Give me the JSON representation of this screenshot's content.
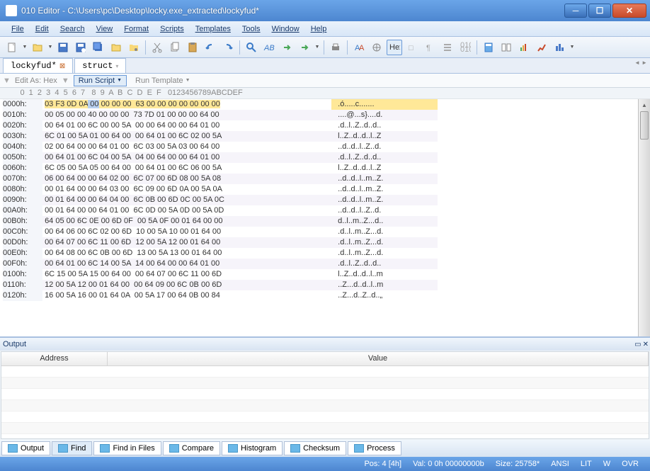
{
  "title": "010 Editor - C:\\Users\\pc\\Desktop\\locky.exe_extracted\\lockyfud*",
  "menus": [
    "File",
    "Edit",
    "Search",
    "View",
    "Format",
    "Scripts",
    "Templates",
    "Tools",
    "Window",
    "Help"
  ],
  "tabs": [
    {
      "label": "lockyfud*",
      "close": true
    },
    {
      "label": "struct",
      "close": false
    }
  ],
  "editbar": {
    "label": "Edit As: Hex",
    "run_script": "Run Script",
    "run_template": "Run Template"
  },
  "hex_header": "        0  1  2  3  4  5  6  7   8  9  A  B  C  D  E  F   0123456789ABCDEF",
  "hex_rows": [
    {
      "off": "0000h:",
      "b": [
        "03",
        "F3",
        "0D",
        "0A",
        "00",
        "00",
        "00",
        "00",
        "63",
        "00",
        "00",
        "00",
        "00",
        "00",
        "00",
        "00"
      ],
      "a": ".ó.....c.......",
      "hl": "yellow",
      "cursor": 4
    },
    {
      "off": "0010h:",
      "b": [
        "00",
        "05",
        "00",
        "00",
        "40",
        "00",
        "00",
        "00",
        "73",
        "7D",
        "01",
        "00",
        "00",
        "00",
        "64",
        "00"
      ],
      "a": "....@...s}....d."
    },
    {
      "off": "0020h:",
      "b": [
        "00",
        "64",
        "01",
        "00",
        "6C",
        "00",
        "00",
        "5A",
        "00",
        "00",
        "64",
        "00",
        "00",
        "64",
        "01",
        "00"
      ],
      "a": ".d..l..Z..d..d.."
    },
    {
      "off": "0030h:",
      "b": [
        "6C",
        "01",
        "00",
        "5A",
        "01",
        "00",
        "64",
        "00",
        "00",
        "64",
        "01",
        "00",
        "6C",
        "02",
        "00",
        "5A"
      ],
      "a": "l..Z..d..d..l..Z"
    },
    {
      "off": "0040h:",
      "b": [
        "02",
        "00",
        "64",
        "00",
        "00",
        "64",
        "01",
        "00",
        "6C",
        "03",
        "00",
        "5A",
        "03",
        "00",
        "64",
        "00"
      ],
      "a": "..d..d..l..Z..d."
    },
    {
      "off": "0050h:",
      "b": [
        "00",
        "64",
        "01",
        "00",
        "6C",
        "04",
        "00",
        "5A",
        "04",
        "00",
        "64",
        "00",
        "00",
        "64",
        "01",
        "00"
      ],
      "a": ".d..l..Z..d..d.."
    },
    {
      "off": "0060h:",
      "b": [
        "6C",
        "05",
        "00",
        "5A",
        "05",
        "00",
        "64",
        "00",
        "00",
        "64",
        "01",
        "00",
        "6C",
        "06",
        "00",
        "5A"
      ],
      "a": "l..Z..d..d..l..Z"
    },
    {
      "off": "0070h:",
      "b": [
        "06",
        "00",
        "64",
        "00",
        "00",
        "64",
        "02",
        "00",
        "6C",
        "07",
        "00",
        "6D",
        "08",
        "00",
        "5A",
        "08"
      ],
      "a": "..d..d..l..m..Z."
    },
    {
      "off": "0080h:",
      "b": [
        "00",
        "01",
        "64",
        "00",
        "00",
        "64",
        "03",
        "00",
        "6C",
        "09",
        "00",
        "6D",
        "0A",
        "00",
        "5A",
        "0A"
      ],
      "a": "..d..d..l..m..Z."
    },
    {
      "off": "0090h:",
      "b": [
        "00",
        "01",
        "64",
        "00",
        "00",
        "64",
        "04",
        "00",
        "6C",
        "0B",
        "00",
        "6D",
        "0C",
        "00",
        "5A",
        "0C"
      ],
      "a": "..d..d..l..m..Z."
    },
    {
      "off": "00A0h:",
      "b": [
        "00",
        "01",
        "64",
        "00",
        "00",
        "64",
        "01",
        "00",
        "6C",
        "0D",
        "00",
        "5A",
        "0D",
        "00",
        "5A",
        "0D"
      ],
      "a": "..d..d..l..Z..d."
    },
    {
      "off": "00B0h:",
      "b": [
        "64",
        "05",
        "00",
        "6C",
        "0E",
        "00",
        "6D",
        "0F",
        "00",
        "5A",
        "0F",
        "00",
        "01",
        "64",
        "00",
        "00"
      ],
      "a": "d..l..m..Z...d.."
    },
    {
      "off": "00C0h:",
      "b": [
        "00",
        "64",
        "06",
        "00",
        "6C",
        "02",
        "00",
        "6D",
        "10",
        "00",
        "5A",
        "10",
        "00",
        "01",
        "64",
        "00"
      ],
      "a": ".d..l..m..Z...d."
    },
    {
      "off": "00D0h:",
      "b": [
        "00",
        "64",
        "07",
        "00",
        "6C",
        "11",
        "00",
        "6D",
        "12",
        "00",
        "5A",
        "12",
        "00",
        "01",
        "64",
        "00"
      ],
      "a": ".d..l..m..Z...d."
    },
    {
      "off": "00E0h:",
      "b": [
        "00",
        "64",
        "08",
        "00",
        "6C",
        "0B",
        "00",
        "6D",
        "13",
        "00",
        "5A",
        "13",
        "00",
        "01",
        "64",
        "00"
      ],
      "a": ".d..l..m..Z...d."
    },
    {
      "off": "00F0h:",
      "b": [
        "00",
        "64",
        "01",
        "00",
        "6C",
        "14",
        "00",
        "5A",
        "14",
        "00",
        "64",
        "00",
        "00",
        "64",
        "01",
        "00"
      ],
      "a": ".d..l..Z..d..d.."
    },
    {
      "off": "0100h:",
      "b": [
        "6C",
        "15",
        "00",
        "5A",
        "15",
        "00",
        "64",
        "00",
        "00",
        "64",
        "07",
        "00",
        "6C",
        "11",
        "00",
        "6D"
      ],
      "a": "l..Z..d..d..l..m"
    },
    {
      "off": "0110h:",
      "b": [
        "12",
        "00",
        "5A",
        "12",
        "00",
        "01",
        "64",
        "00",
        "00",
        "64",
        "09",
        "00",
        "6C",
        "0B",
        "00",
        "6D"
      ],
      "a": "..Z...d..d..l..m"
    },
    {
      "off": "0120h:",
      "b": [
        "16",
        "00",
        "5A",
        "16",
        "00",
        "01",
        "64",
        "0A",
        "00",
        "5A",
        "17",
        "00",
        "64",
        "0B",
        "00",
        "84"
      ],
      "a": "..Z...d..Z..d..„"
    }
  ],
  "output": {
    "title": "Output",
    "cols": [
      "Address",
      "Value"
    ]
  },
  "bottom_tabs": [
    {
      "label": "Output"
    },
    {
      "label": "Find",
      "active": true
    },
    {
      "label": "Find in Files"
    },
    {
      "label": "Compare"
    },
    {
      "label": "Histogram"
    },
    {
      "label": "Checksum"
    },
    {
      "label": "Process"
    }
  ],
  "status": {
    "pos": "Pos: 4 [4h]",
    "val": "Val: 0 0h 00000000b",
    "size": "Size: 25758*",
    "enc": "ANSI",
    "end": "LIT",
    "w": "W",
    "ovr": "OVR"
  }
}
